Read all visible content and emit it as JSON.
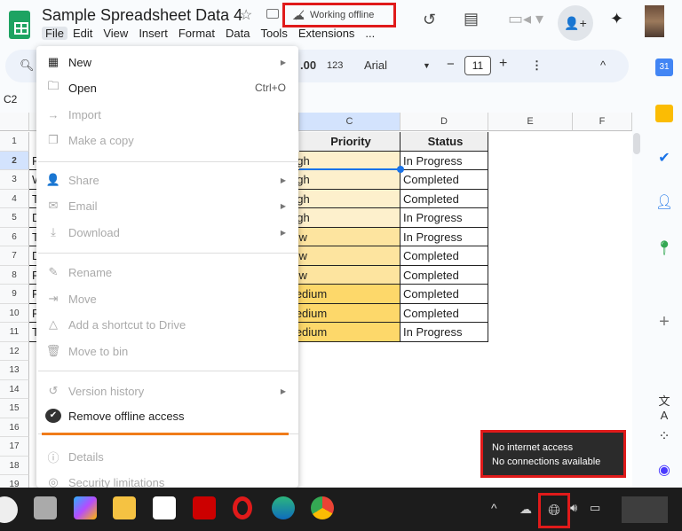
{
  "header": {
    "title": "Sample Spreadsheet Data 4",
    "offline_status": "Working offline",
    "menu": [
      "File",
      "Edit",
      "View",
      "Insert",
      "Format",
      "Data",
      "Tools",
      "Extensions",
      "..."
    ]
  },
  "toolbar": {
    "decimal": ".00",
    "format_123": "123",
    "font": "Arial",
    "font_size": "11",
    "minus": "−",
    "plus": "+"
  },
  "namebox": "C2",
  "columns": [
    "C",
    "D",
    "E",
    "F"
  ],
  "rows": [
    "1",
    "2",
    "3",
    "4",
    "5",
    "6",
    "7",
    "8",
    "9",
    "10",
    "11",
    "12",
    "13",
    "14",
    "15",
    "16",
    "17",
    "18",
    "19"
  ],
  "table": {
    "headers": {
      "priority": "Priority",
      "status": "Status"
    },
    "col_a": [
      "F",
      "W",
      "T",
      "D",
      "T",
      "D",
      "F",
      "F",
      "F",
      "T"
    ],
    "priority": [
      "High",
      "High",
      "High",
      "High",
      "Low",
      "Low",
      "Low",
      "Medium",
      "Medium",
      "Medium"
    ],
    "status": [
      "In Progress",
      "Completed",
      "Completed",
      "In Progress",
      "In Progress",
      "Completed",
      "Completed",
      "Completed",
      "Completed",
      "In Progress"
    ]
  },
  "file_menu": [
    {
      "label": "New",
      "icon": "new-sheet-icon",
      "arrow": true
    },
    {
      "label": "Open",
      "icon": "folder-icon",
      "shortcut": "Ctrl+O"
    },
    {
      "label": "Import",
      "icon": "import-icon",
      "disabled": true
    },
    {
      "label": "Make a copy",
      "icon": "copy-icon",
      "disabled": true
    },
    {
      "label": "Share",
      "icon": "share-icon",
      "disabled": true,
      "arrow": true
    },
    {
      "label": "Email",
      "icon": "email-icon",
      "disabled": true,
      "arrow": true
    },
    {
      "label": "Download",
      "icon": "download-icon",
      "disabled": true,
      "arrow": true
    },
    {
      "label": "Rename",
      "icon": "pencil-icon",
      "disabled": true
    },
    {
      "label": "Move",
      "icon": "move-icon",
      "disabled": true
    },
    {
      "label": "Add a shortcut to Drive",
      "icon": "drive-shortcut-icon",
      "disabled": true
    },
    {
      "label": "Move to bin",
      "icon": "trash-icon",
      "disabled": true
    },
    {
      "label": "Version history",
      "icon": "history-icon",
      "disabled": true,
      "arrow": true
    },
    {
      "label": "Remove offline access",
      "icon": "offline-check-icon"
    },
    {
      "label": "Details",
      "icon": "info-icon",
      "disabled": true
    },
    {
      "label": "Security limitations",
      "icon": "security-icon",
      "disabled": true
    }
  ],
  "tooltip": {
    "line1": "No internet access",
    "line2": "No connections available"
  },
  "colors": {
    "priority_high": "#fdf0cc",
    "priority_low": "#fde49f",
    "priority_medium": "#fdd86a",
    "highlight": "#e01a1a",
    "accent": "#f07c1a"
  }
}
